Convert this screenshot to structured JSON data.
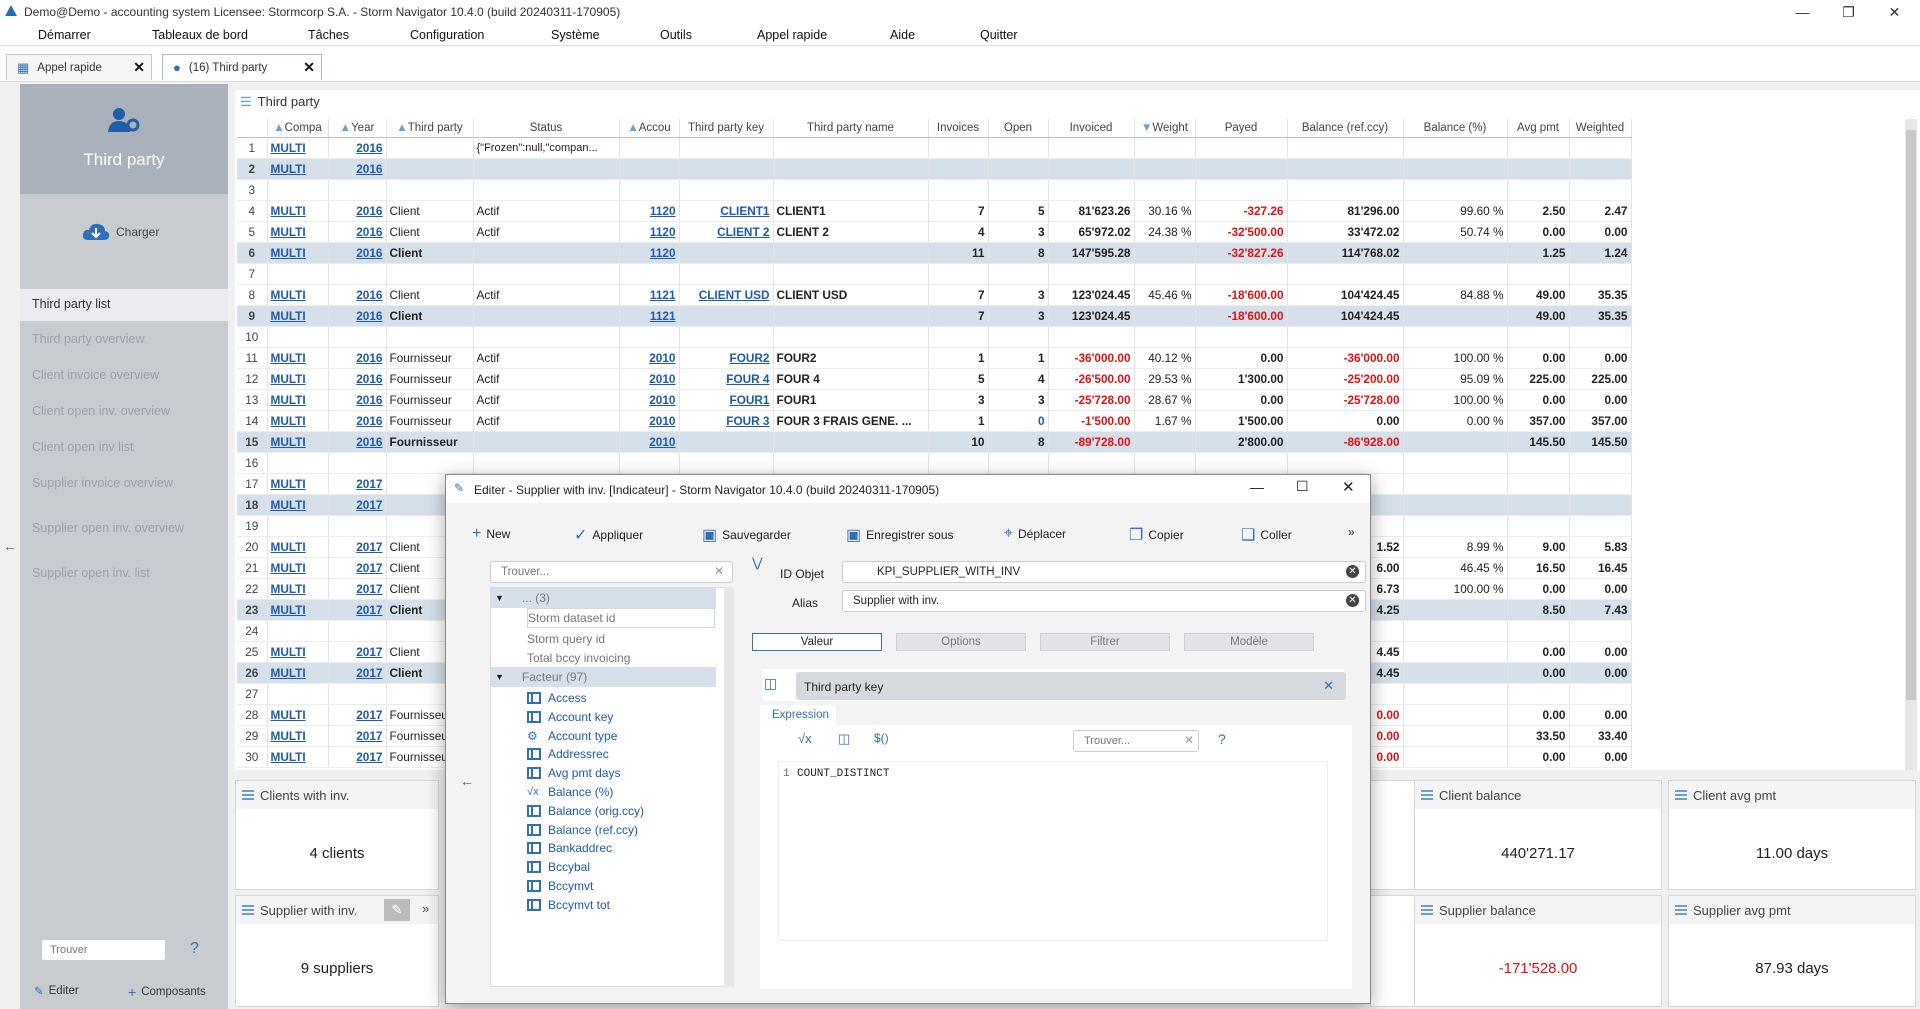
{
  "window": {
    "title": "Demo@Demo - accounting system   Licensee: Stormcorp S.A. - Storm Navigator 10.4.0 (build 20240311-170905)"
  },
  "menu": [
    "Démarrer",
    "Tableaux de bord",
    "Tâches",
    "Configuration",
    "Système",
    "Outils",
    "Appel rapide",
    "Aide",
    "Quitter"
  ],
  "tabs": [
    {
      "label": "Appel rapide"
    },
    {
      "label": "(16) Third party"
    }
  ],
  "sidebar": {
    "title": "Third party",
    "load_label": "Charger",
    "items": [
      "Third party list",
      "Third party overview",
      "Client invoice overview",
      "Client open inv. overview",
      "Client open inv list",
      "Supplier invoice overview",
      "Supplier open inv. overview",
      "Supplier open inv. list"
    ],
    "search_placeholder": "Trouver",
    "help": "?",
    "edit_label": "Editer",
    "components_label": "Composants"
  },
  "grid": {
    "title": "Third party",
    "columns": [
      "",
      "Compa",
      "Year",
      "Third party",
      "Status",
      "Accou",
      "Third party key",
      "Third party name",
      "Invoices",
      "Open",
      "Invoiced",
      "Weight",
      "Payed",
      "Balance (ref.ccy)",
      "Balance (%)",
      "Avg pmt",
      "Weighted"
    ],
    "rows": [
      {
        "n": "1",
        "comp": "MULTI",
        "year": "2016",
        "tp": "",
        "status": "{\"Frozen\":null,\"compan...",
        "acc": "",
        "key": "",
        "name": "",
        "inv": "",
        "open": "",
        "invd": "",
        "weight": "",
        "payed": "",
        "bal": "",
        "balp": "",
        "avg": "",
        "wgt": "",
        "sub": false
      },
      {
        "n": "2",
        "comp": "MULTI",
        "year": "2016",
        "tp": "",
        "status": "",
        "acc": "",
        "key": "",
        "name": "",
        "inv": "",
        "open": "",
        "invd": "",
        "weight": "",
        "payed": "",
        "bal": "",
        "balp": "",
        "avg": "",
        "wgt": "",
        "sub": true
      },
      {
        "n": "3",
        "empty": true
      },
      {
        "n": "4",
        "comp": "MULTI",
        "year": "2016",
        "tp": "Client",
        "status": "Actif",
        "acc": "1120",
        "key": "CLIENT1",
        "name": "CLIENT1",
        "inv": "7",
        "open": "5",
        "invd": "81'623.26",
        "weight": "30.16 %",
        "payed": "-327.26",
        "bal": "81'296.00",
        "balp": "99.60 %",
        "avg": "2.50",
        "wgt": "2.47",
        "sub": false
      },
      {
        "n": "5",
        "comp": "MULTI",
        "year": "2016",
        "tp": "Client",
        "status": "Actif",
        "acc": "1120",
        "key": "CLIENT 2",
        "name": "CLIENT 2",
        "inv": "4",
        "open": "3",
        "invd": "65'972.02",
        "weight": "24.38 %",
        "payed": "-32'500.00",
        "bal": "33'472.02",
        "balp": "50.74 %",
        "avg": "0.00",
        "wgt": "0.00",
        "sub": false
      },
      {
        "n": "6",
        "comp": "MULTI",
        "year": "2016",
        "tp": "Client",
        "status": "",
        "acc": "1120",
        "key": "",
        "name": "",
        "inv": "11",
        "open": "8",
        "invd": "147'595.28",
        "weight": "",
        "payed": "-32'827.26",
        "bal": "114'768.02",
        "balp": "",
        "avg": "1.25",
        "wgt": "1.24",
        "sub": true
      },
      {
        "n": "7",
        "empty": true
      },
      {
        "n": "8",
        "comp": "MULTI",
        "year": "2016",
        "tp": "Client",
        "status": "Actif",
        "acc": "1121",
        "key": "CLIENT USD",
        "name": "CLIENT USD",
        "inv": "7",
        "open": "3",
        "invd": "123'024.45",
        "weight": "45.46 %",
        "payed": "-18'600.00",
        "bal": "104'424.45",
        "balp": "84.88 %",
        "avg": "49.00",
        "wgt": "35.35",
        "sub": false
      },
      {
        "n": "9",
        "comp": "MULTI",
        "year": "2016",
        "tp": "Client",
        "status": "",
        "acc": "1121",
        "key": "",
        "name": "",
        "inv": "7",
        "open": "3",
        "invd": "123'024.45",
        "weight": "",
        "payed": "-18'600.00",
        "bal": "104'424.45",
        "balp": "",
        "avg": "49.00",
        "wgt": "35.35",
        "sub": true
      },
      {
        "n": "10",
        "empty": true
      },
      {
        "n": "11",
        "comp": "MULTI",
        "year": "2016",
        "tp": "Fournisseur",
        "status": "Actif",
        "acc": "2010",
        "key": "FOUR2",
        "name": "FOUR2",
        "inv": "1",
        "open": "1",
        "invd": "-36'000.00",
        "weight": "40.12 %",
        "payed": "0.00",
        "bal": "-36'000.00",
        "balp": "100.00 %",
        "avg": "0.00",
        "wgt": "0.00",
        "sub": false
      },
      {
        "n": "12",
        "comp": "MULTI",
        "year": "2016",
        "tp": "Fournisseur",
        "status": "Actif",
        "acc": "2010",
        "key": "FOUR 4",
        "name": "FOUR 4",
        "inv": "5",
        "open": "4",
        "invd": "-26'500.00",
        "weight": "29.53 %",
        "payed": "1'300.00",
        "bal": "-25'200.00",
        "balp": "95.09 %",
        "avg": "225.00",
        "wgt": "225.00",
        "sub": false
      },
      {
        "n": "13",
        "comp": "MULTI",
        "year": "2016",
        "tp": "Fournisseur",
        "status": "Actif",
        "acc": "2010",
        "key": "FOUR1",
        "name": "FOUR1",
        "inv": "3",
        "open": "3",
        "invd": "-25'728.00",
        "weight": "28.67 %",
        "payed": "0.00",
        "bal": "-25'728.00",
        "balp": "100.00 %",
        "avg": "0.00",
        "wgt": "0.00",
        "sub": false
      },
      {
        "n": "14",
        "comp": "MULTI",
        "year": "2016",
        "tp": "Fournisseur",
        "status": "Actif",
        "acc": "2010",
        "key": "FOUR 3",
        "name": "FOUR 3 FRAIS GENE. ...",
        "inv": "1",
        "open": "0",
        "invd": "-1'500.00",
        "weight": "1.67 %",
        "payed": "1'500.00",
        "bal": "0.00",
        "balp": "0.00 %",
        "avg": "357.00",
        "wgt": "357.00",
        "sub": false
      },
      {
        "n": "15",
        "comp": "MULTI",
        "year": "2016",
        "tp": "Fournisseur",
        "status": "",
        "acc": "2010",
        "key": "",
        "name": "",
        "inv": "10",
        "open": "8",
        "invd": "-89'728.00",
        "weight": "",
        "payed": "2'800.00",
        "bal": "-86'928.00",
        "balp": "",
        "avg": "145.50",
        "wgt": "145.50",
        "sub": true
      },
      {
        "n": "16",
        "empty": true
      },
      {
        "n": "17",
        "comp": "MULTI",
        "year": "2017",
        "tp": "",
        "status": "",
        "acc": "",
        "key": "",
        "name": "",
        "inv": "",
        "open": "",
        "invd": "",
        "weight": "",
        "payed": "",
        "bal": "",
        "balp": "",
        "avg": "",
        "wgt": "",
        "sub": false
      },
      {
        "n": "18",
        "comp": "MULTI",
        "year": "2017",
        "tp": "",
        "status": "",
        "acc": "",
        "key": "",
        "name": "",
        "inv": "",
        "open": "",
        "invd": "",
        "weight": "",
        "payed": "",
        "bal": "",
        "balp": "",
        "avg": "",
        "wgt": "",
        "sub": true
      },
      {
        "n": "19",
        "empty": true
      },
      {
        "n": "20",
        "comp": "MULTI",
        "year": "2017",
        "tp": "Client",
        "status": "",
        "acc": "",
        "key": "",
        "name": "",
        "inv": "",
        "open": "",
        "invd": "",
        "weight": "",
        "payed": "",
        "bal": "1.52",
        "balp": "8.99 %",
        "avg": "9.00",
        "wgt": "5.83",
        "sub": false
      },
      {
        "n": "21",
        "comp": "MULTI",
        "year": "2017",
        "tp": "Client",
        "status": "",
        "acc": "",
        "key": "",
        "name": "",
        "inv": "",
        "open": "",
        "invd": "",
        "weight": "",
        "payed": "",
        "bal": "6.00",
        "balp": "46.45 %",
        "avg": "16.50",
        "wgt": "16.45",
        "sub": false
      },
      {
        "n": "22",
        "comp": "MULTI",
        "year": "2017",
        "tp": "Client",
        "status": "",
        "acc": "",
        "key": "",
        "name": "",
        "inv": "",
        "open": "",
        "invd": "",
        "weight": "",
        "payed": "",
        "bal": "6.73",
        "balp": "100.00 %",
        "avg": "0.00",
        "wgt": "0.00",
        "sub": false
      },
      {
        "n": "23",
        "comp": "MULTI",
        "year": "2017",
        "tp": "Client",
        "status": "",
        "acc": "",
        "key": "",
        "name": "",
        "inv": "",
        "open": "",
        "invd": "",
        "weight": "",
        "payed": "",
        "bal": "4.25",
        "balp": "",
        "avg": "8.50",
        "wgt": "7.43",
        "sub": true
      },
      {
        "n": "24",
        "empty": true
      },
      {
        "n": "25",
        "comp": "MULTI",
        "year": "2017",
        "tp": "Client",
        "status": "",
        "acc": "",
        "key": "",
        "name": "",
        "inv": "",
        "open": "",
        "invd": "",
        "weight": "",
        "payed": "",
        "bal": "4.45",
        "balp": "",
        "avg": "0.00",
        "wgt": "0.00",
        "sub": false
      },
      {
        "n": "26",
        "comp": "MULTI",
        "year": "2017",
        "tp": "Client",
        "status": "",
        "acc": "",
        "key": "",
        "name": "",
        "inv": "",
        "open": "",
        "invd": "",
        "weight": "",
        "payed": "",
        "bal": "4.45",
        "balp": "",
        "avg": "0.00",
        "wgt": "0.00",
        "sub": true
      },
      {
        "n": "27",
        "empty": true
      },
      {
        "n": "28",
        "comp": "MULTI",
        "year": "2017",
        "tp": "Fournisseur",
        "status": "",
        "acc": "",
        "key": "",
        "name": "",
        "inv": "",
        "open": "",
        "invd": "",
        "weight": "",
        "payed": "",
        "bal": "0.00",
        "balp": "",
        "avg": "0.00",
        "wgt": "0.00",
        "sub": false
      },
      {
        "n": "29",
        "comp": "MULTI",
        "year": "2017",
        "tp": "Fournisseur",
        "status": "",
        "acc": "",
        "key": "",
        "name": "",
        "inv": "",
        "open": "",
        "invd": "",
        "weight": "",
        "payed": "",
        "bal": "0.00",
        "balp": "",
        "avg": "33.50",
        "wgt": "33.40",
        "sub": false
      },
      {
        "n": "30",
        "comp": "MULTI",
        "year": "2017",
        "tp": "Fournisseur",
        "status": "",
        "acc": "",
        "key": "",
        "name": "",
        "inv": "",
        "open": "",
        "invd": "",
        "weight": "",
        "payed": "",
        "bal": "0.00",
        "balp": "",
        "avg": "0.00",
        "wgt": "0.00",
        "sub": false
      }
    ]
  },
  "cards": {
    "clients_with_inv": {
      "title": "Clients with inv.",
      "value": "4 clients"
    },
    "supplier_with_inv": {
      "title": "Supplier with inv.",
      "value": "9 suppliers"
    },
    "client_balance": {
      "title": "Client balance",
      "value": "440'271.17"
    },
    "client_avg_pmt": {
      "title": "Client avg pmt",
      "value": "11.00 days"
    },
    "supplier_balance": {
      "title": "Supplier balance",
      "value": "-171'528.00"
    },
    "supplier_avg_pmt": {
      "title": "Supplier avg pmt",
      "value": "87.93 days"
    }
  },
  "dialog": {
    "title": "Editer - Supplier with inv. [Indicateur] -  Storm Navigator 10.4.0 (build 20240311-170905)",
    "toolbar": [
      "New",
      "Appliquer",
      "Sauvegarder",
      "Enregistrer sous",
      "Déplacer",
      "Copier",
      "Coller"
    ],
    "more": "»",
    "tree_search_placeholder": "Trouver...",
    "tree": {
      "group1": "... (3)",
      "group1_items": [
        "Storm dataset id",
        "Storm query id",
        "Total bccy invoicing"
      ],
      "group2": "Facteur (97)",
      "group2_items": [
        "Access",
        "Account key",
        "Account type",
        "Addressrec",
        "Avg pmt days",
        "Balance (%)",
        "Balance (orig.ccy)",
        "Balance (ref.ccy)",
        "Bankaddrec",
        "Bccybal",
        "Bccymvt",
        "Bccymvt tot"
      ]
    },
    "id_label": "ID Objet",
    "id_value": "KPI_SUPPLIER_WITH_INV",
    "alias_label": "Alias",
    "alias_value": "Supplier with inv.",
    "tabs": [
      "Valeur",
      "Options",
      "Filtrer",
      "Modèle"
    ],
    "field_title": "Third party key",
    "expression_tab": "Expression",
    "expr_search_placeholder": "Trouver...",
    "expr_help": "?",
    "code_line_no": "1",
    "code": "COUNT_DISTINCT"
  },
  "colors": {
    "link": "#1f5aa8",
    "negative": "#dd1111",
    "subtotal_row": "#d6e0ea",
    "accent": "#2f6fb5"
  }
}
